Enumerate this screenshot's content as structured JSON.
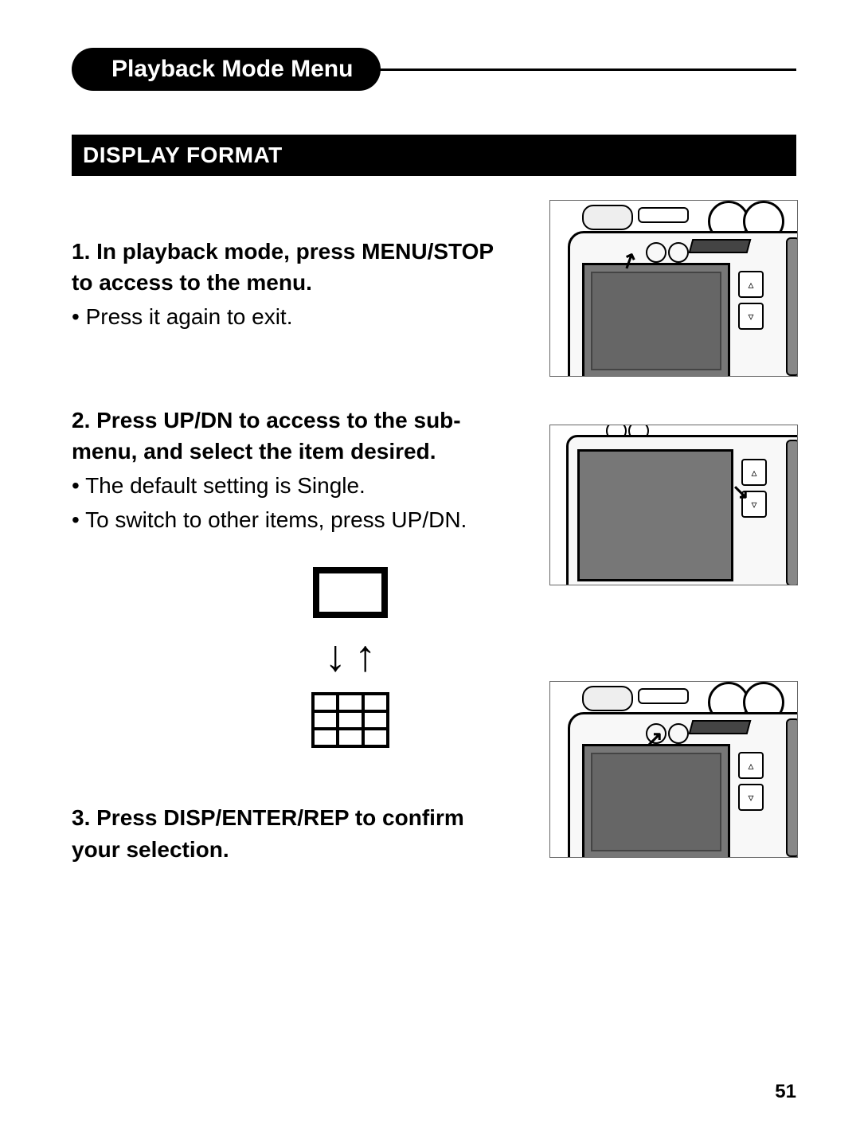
{
  "header": {
    "title": "Playback Mode Menu"
  },
  "section": {
    "title": "DISPLAY FORMAT"
  },
  "steps": {
    "s1": {
      "head": "1. In playback mode, press MENU/STOP to access to the menu.",
      "b1": "• Press it again to exit."
    },
    "s2": {
      "head": "2. Press UP/DN to access to the sub-menu, and select the item desired.",
      "b1": "• The default setting is Single.",
      "b2": "• To switch to other items, press UP/DN."
    },
    "s3": {
      "head": "3. Press DISP/ENTER/REP to confirm your selection."
    }
  },
  "diagram": {
    "down": "↓",
    "up": "↑"
  },
  "pagenum": "51"
}
